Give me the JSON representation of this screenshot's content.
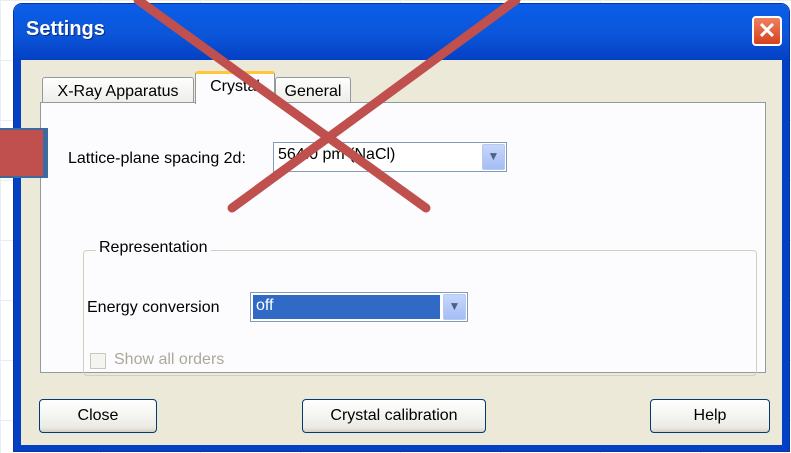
{
  "window": {
    "title": "Settings",
    "close_glyph": "✕"
  },
  "tabs": [
    {
      "label": "X-Ray Apparatus",
      "active": false
    },
    {
      "label": "Crystal",
      "active": true
    },
    {
      "label": "General",
      "active": false
    }
  ],
  "crystal": {
    "lattice_label": "Lattice-plane spacing 2d:",
    "lattice_value": "564.0 pm (NaCl)",
    "representation_label": "Representation",
    "energy_label": "Energy conversion",
    "energy_value": "off",
    "show_all_orders_label": "Show all orders",
    "show_all_orders_checked": false,
    "show_all_orders_enabled": false
  },
  "buttons": {
    "close": "Close",
    "calibration": "Crystal calibration",
    "help": "Help"
  },
  "annotation": {
    "cross_color": "#c0504d",
    "marker_fill": "#c0504d",
    "marker_border": "#3c6ba0"
  }
}
